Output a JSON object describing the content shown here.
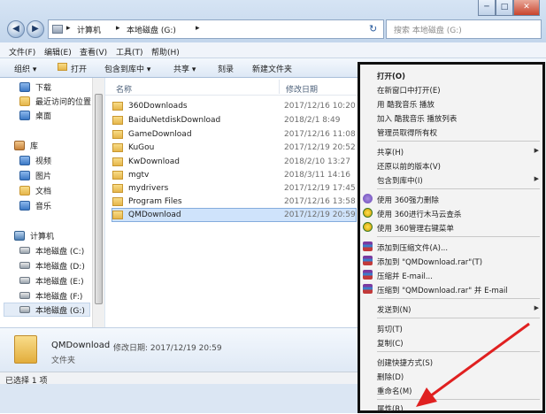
{
  "window": {
    "controls": [
      "─",
      "□",
      "✕"
    ],
    "address": {
      "separator": "▸",
      "segments": [
        "计算机",
        "本地磁盘 (G:)"
      ]
    },
    "search_placeholder": "搜索 本地磁盘 (G:)"
  },
  "menubar": [
    "文件(F)",
    "编辑(E)",
    "查看(V)",
    "工具(T)",
    "帮助(H)"
  ],
  "toolbar": [
    "组织 ▾",
    "打开",
    "包含到库中 ▾",
    "共享 ▾",
    "刻录",
    "新建文件夹"
  ],
  "navpane": {
    "items": [
      {
        "label": "下载",
        "icon": "download-folder-icon"
      },
      {
        "label": "最近访问的位置",
        "icon": "recent-places-icon"
      },
      {
        "label": "桌面",
        "icon": "desktop-icon"
      },
      {
        "label": "库",
        "icon": "library-icon"
      },
      {
        "label": "视频",
        "icon": "video-icon"
      },
      {
        "label": "图片",
        "icon": "pictures-icon"
      },
      {
        "label": "文档",
        "icon": "documents-icon"
      },
      {
        "label": "音乐",
        "icon": "music-icon"
      },
      {
        "label": "计算机",
        "icon": "computer-icon"
      },
      {
        "label": "本地磁盘 (C:)",
        "icon": "drive-icon"
      },
      {
        "label": "本地磁盘 (D:)",
        "icon": "drive-icon"
      },
      {
        "label": "本地磁盘 (E:)",
        "icon": "drive-icon"
      },
      {
        "label": "本地磁盘 (F:)",
        "icon": "drive-icon"
      },
      {
        "label": "本地磁盘 (G:)",
        "icon": "drive-icon"
      }
    ]
  },
  "filelist": {
    "columns": {
      "name": "名称",
      "date": "修改日期"
    },
    "rows": [
      {
        "name": "360Downloads",
        "date": "2017/12/16 10:20"
      },
      {
        "name": "BaiduNetdiskDownload",
        "date": "2018/2/1 8:49"
      },
      {
        "name": "GameDownload",
        "date": "2017/12/16 11:08"
      },
      {
        "name": "KuGou",
        "date": "2017/12/19 20:52"
      },
      {
        "name": "KwDownload",
        "date": "2018/2/10 13:27"
      },
      {
        "name": "mgtv",
        "date": "2018/3/11 14:16"
      },
      {
        "name": "mydrivers",
        "date": "2017/12/19 17:45"
      },
      {
        "name": "Program Files",
        "date": "2017/12/16 13:58"
      },
      {
        "name": "QMDownload",
        "date": "2017/12/19 20:59"
      }
    ]
  },
  "details": {
    "name": "QMDownload",
    "meta": "修改日期: 2017/12/19 20:59",
    "type": "文件夹"
  },
  "statusbar": {
    "text": "已选择 1 项"
  },
  "context_menu": {
    "submenu_arrow": "▶",
    "items": [
      {
        "label": "打开(O)"
      },
      {
        "label": "在新窗口中打开(E)"
      },
      {
        "label": "用 酷我音乐 播放"
      },
      {
        "label": "加入 酷我音乐 播放列表"
      },
      {
        "label": "管理员取得所有权"
      },
      {
        "label": "共享(H)"
      },
      {
        "label": "还原以前的版本(V)"
      },
      {
        "label": "包含到库中(I)"
      },
      {
        "label": "使用 360强力删除"
      },
      {
        "label": "使用 360进行木马云查杀"
      },
      {
        "label": "使用 360管理右键菜单"
      },
      {
        "label": "添加到压缩文件(A)..."
      },
      {
        "label": "添加到 \"QMDownload.rar\"(T)"
      },
      {
        "label": "压缩并 E-mail..."
      },
      {
        "label": "压缩到 \"QMDownload.rar\" 并 E-mail"
      },
      {
        "label": "发送到(N)"
      },
      {
        "label": "剪切(T)"
      },
      {
        "label": "复制(C)"
      },
      {
        "label": "创建快捷方式(S)"
      },
      {
        "label": "删除(D)"
      },
      {
        "label": "重命名(M)"
      },
      {
        "label": "属性(R)"
      }
    ]
  },
  "colors": {
    "highlight": "#cfe3fb",
    "arrow": "#e02020",
    "menu_border": "#101010"
  }
}
